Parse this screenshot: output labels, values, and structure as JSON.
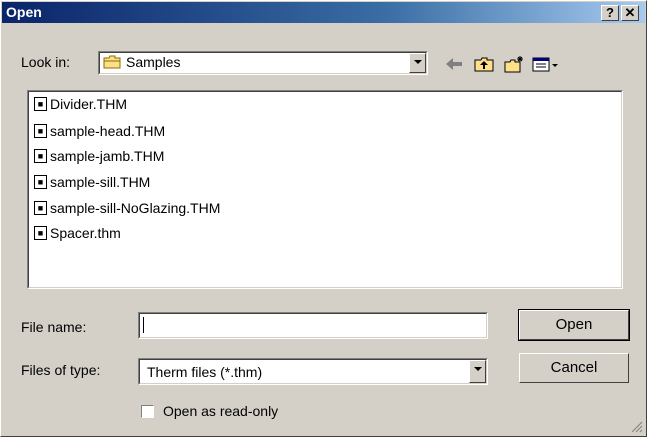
{
  "window": {
    "title": "Open",
    "help_label": "?",
    "close_label": "✕"
  },
  "look_in": {
    "label": "Look in:",
    "value": "Samples",
    "icon": "folder-icon"
  },
  "toolbar": {
    "back_icon": "back-arrow-icon",
    "up_icon": "up-folder-icon",
    "new_folder_icon": "new-folder-icon",
    "view_icon": "view-menu-icon"
  },
  "files": [
    {
      "name": "Divider.THM"
    },
    {
      "name": "sample-head.THM"
    },
    {
      "name": "sample-jamb.THM"
    },
    {
      "name": "sample-sill.THM"
    },
    {
      "name": "sample-sill-NoGlazing.THM"
    },
    {
      "name": "Spacer.thm"
    }
  ],
  "file_name": {
    "label": "File name:",
    "value": ""
  },
  "file_type": {
    "label": "Files of type:",
    "value": "Therm files (*.thm)"
  },
  "buttons": {
    "open": "Open",
    "cancel": "Cancel"
  },
  "read_only": {
    "label": "Open as read-only",
    "checked": false
  }
}
